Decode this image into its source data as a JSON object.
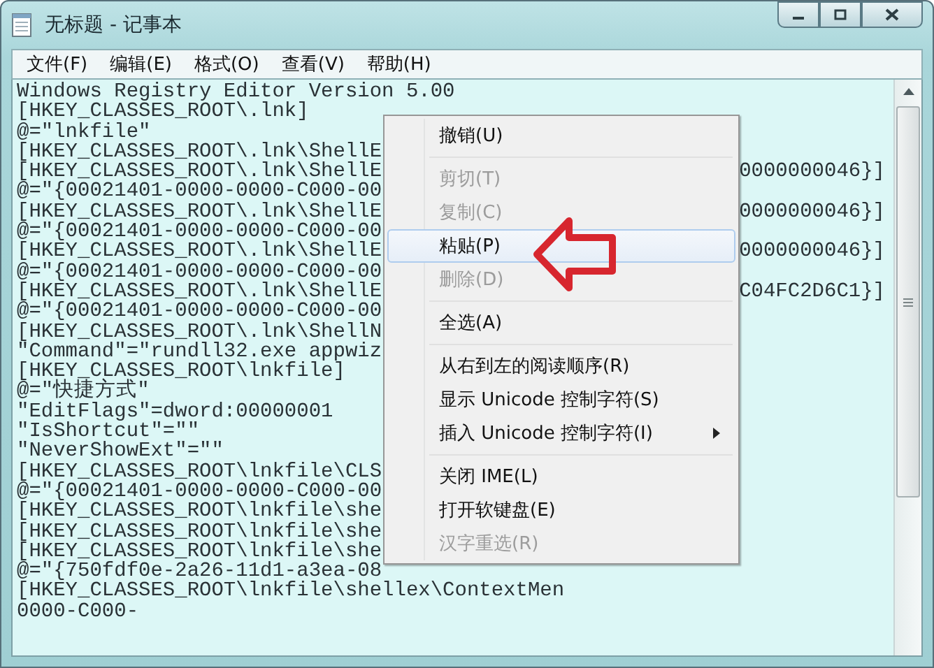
{
  "window": {
    "title": "无标题 - 记事本"
  },
  "menu_bar": [
    {
      "label": "文件(F)"
    },
    {
      "label": "编辑(E)"
    },
    {
      "label": "格式(O)"
    },
    {
      "label": "查看(V)"
    },
    {
      "label": "帮助(H)"
    }
  ],
  "lines": [
    {
      "text": "Windows Registry Editor Version 5.00"
    },
    {
      "text": "[HKEY_CLASSES_ROOT\\.lnk]"
    },
    {
      "text": "@=\"lnkfile\""
    },
    {
      "text": "[HKEY_CLASSES_ROOT\\.lnk\\ShellE"
    },
    {
      "text": "[HKEY_CLASSES_ROOT\\.lnk\\ShellE",
      "tail": "0000000046}]"
    },
    {
      "text": "@=\"{00021401-0000-0000-C000-00"
    },
    {
      "text": "[HKEY_CLASSES_ROOT\\.lnk\\ShellE",
      "tail": "0000000046}]"
    },
    {
      "text": "@=\"{00021401-0000-0000-C000-00"
    },
    {
      "text": "[HKEY_CLASSES_ROOT\\.lnk\\ShellE",
      "tail": "0000000046}]"
    },
    {
      "text": "@=\"{00021401-0000-0000-C000-00"
    },
    {
      "text": "[HKEY_CLASSES_ROOT\\.lnk\\ShellE",
      "tail": "C04FC2D6C1}]"
    },
    {
      "text": "@=\"{00021401-0000-0000-C000-00"
    },
    {
      "text": "[HKEY_CLASSES_ROOT\\.lnk\\ShellN"
    },
    {
      "text": "\"Command\"=\"rundll32.exe appwiz"
    },
    {
      "text": "[HKEY_CLASSES_ROOT\\lnkfile]"
    },
    {
      "text": "@=\"快捷方式\""
    },
    {
      "text": "\"EditFlags\"=dword:00000001"
    },
    {
      "text": "\"IsShortcut\"=\"\""
    },
    {
      "text": "\"NeverShowExt\"=\"\""
    },
    {
      "text": "[HKEY_CLASSES_ROOT\\lnkfile\\CLS"
    },
    {
      "text": "@=\"{00021401-0000-0000-C000-00"
    },
    {
      "text": "[HKEY_CLASSES_ROOT\\lnkfile\\she"
    },
    {
      "text": "[HKEY_CLASSES_ROOT\\lnkfile\\she"
    },
    {
      "text": "[HKEY_CLASSES_ROOT\\lnkfile\\she"
    },
    {
      "text": "@=\"{750fdf0e-2a26-11d1-a3ea-08"
    },
    {
      "text": "[HKEY_CLASSES_ROOT\\lnkfile\\shellex\\ContextMen"
    },
    {
      "text": "0000-C000-"
    }
  ],
  "context_menu": [
    {
      "kind": "item",
      "label": "撤销(U)",
      "disabled": false,
      "selected": false
    },
    {
      "kind": "separator"
    },
    {
      "kind": "item",
      "label": "剪切(T)",
      "disabled": true,
      "selected": false
    },
    {
      "kind": "item",
      "label": "复制(C)",
      "disabled": true,
      "selected": false
    },
    {
      "kind": "item",
      "label": "粘贴(P)",
      "disabled": false,
      "selected": true
    },
    {
      "kind": "item",
      "label": "删除(D)",
      "disabled": true,
      "selected": false
    },
    {
      "kind": "separator"
    },
    {
      "kind": "item",
      "label": "全选(A)",
      "disabled": false,
      "selected": false
    },
    {
      "kind": "separator"
    },
    {
      "kind": "item",
      "label": "从右到左的阅读顺序(R)",
      "disabled": false,
      "selected": false
    },
    {
      "kind": "item",
      "label": "显示 Unicode 控制字符(S)",
      "disabled": false,
      "selected": false
    },
    {
      "kind": "item",
      "label": "插入 Unicode 控制字符(I)",
      "disabled": false,
      "selected": false,
      "submenu": true
    },
    {
      "kind": "separator"
    },
    {
      "kind": "item",
      "label": "关闭 IME(L)",
      "disabled": false,
      "selected": false
    },
    {
      "kind": "item",
      "label": "打开软键盘(E)",
      "disabled": false,
      "selected": false
    },
    {
      "kind": "item",
      "label": "汉字重选(R)",
      "disabled": true,
      "selected": false
    }
  ]
}
